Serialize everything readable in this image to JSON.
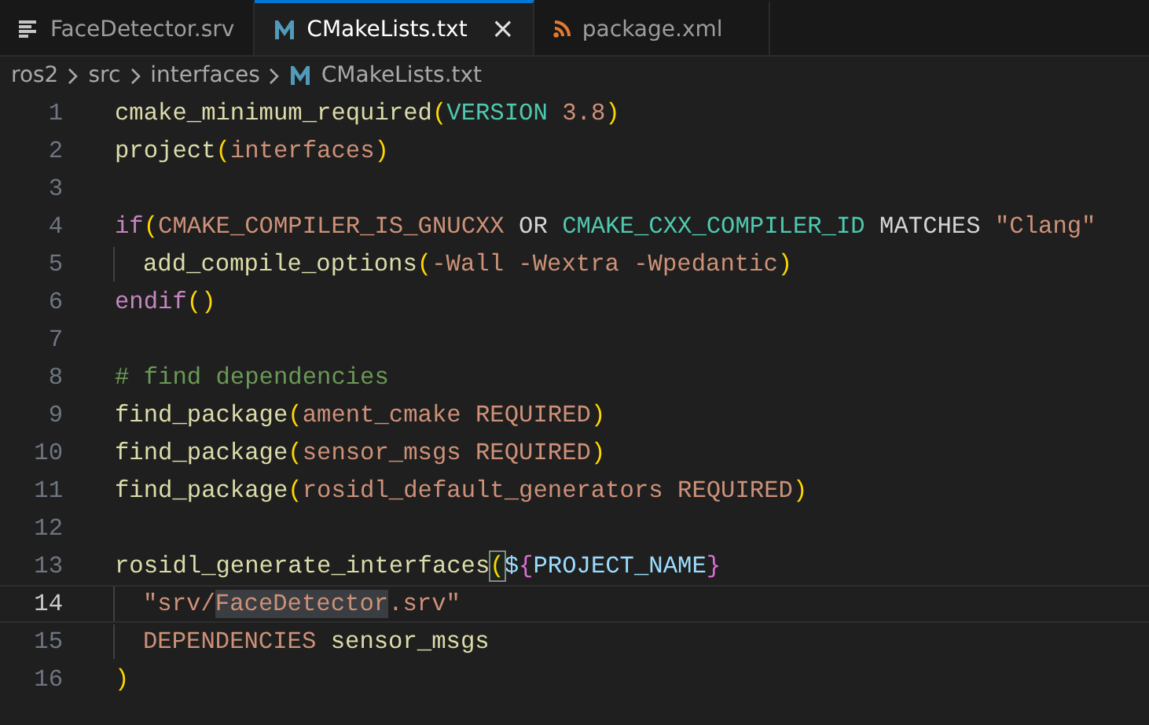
{
  "tabs": [
    {
      "label": "FaceDetector.srv",
      "kind": "text",
      "selected": false
    },
    {
      "label": "CMakeLists.txt",
      "kind": "cmake",
      "selected": true,
      "close": "×"
    },
    {
      "label": "package.xml",
      "kind": "xml",
      "selected": false
    }
  ],
  "breadcrumbs": [
    {
      "label": "ros2",
      "kind": "folder"
    },
    {
      "label": "src",
      "kind": "folder"
    },
    {
      "label": "interfaces",
      "kind": "folder"
    },
    {
      "label": "CMakeLists.txt",
      "kind": "cmake"
    }
  ],
  "lines": [
    {
      "number": "1",
      "current": false,
      "indent": false,
      "tokens": [
        {
          "text": "cmake_minimum_required",
          "kind": "fn"
        },
        {
          "text": "(",
          "kind": "paren"
        },
        {
          "text": "VERSION",
          "kind": "const"
        },
        {
          "text": " 3.8",
          "kind": "arg"
        },
        {
          "text": ")",
          "kind": "paren"
        }
      ]
    },
    {
      "number": "2",
      "current": false,
      "indent": false,
      "tokens": [
        {
          "text": "project",
          "kind": "fn"
        },
        {
          "text": "(",
          "kind": "paren"
        },
        {
          "text": "interfaces",
          "kind": "arg"
        },
        {
          "text": ")",
          "kind": "paren"
        }
      ]
    },
    {
      "number": "3",
      "current": false,
      "indent": false
    },
    {
      "number": "4",
      "current": false,
      "indent": false,
      "tokens": [
        {
          "text": "if",
          "kind": "keyword"
        },
        {
          "text": "(",
          "kind": "paren"
        },
        {
          "text": "CMAKE_COMPILER_IS_GNUCXX",
          "kind": "arg"
        },
        {
          "text": " OR ",
          "kind": "plain"
        },
        {
          "text": "CMAKE_CXX_COMPILER_ID",
          "kind": "const"
        },
        {
          "text": " MATCHES ",
          "kind": "plain"
        },
        {
          "text": "\"Clang\"",
          "kind": "arg"
        }
      ]
    },
    {
      "number": "5",
      "current": false,
      "indent": true,
      "tokens": [
        {
          "text": "add_compile_options",
          "kind": "fn"
        },
        {
          "text": "(",
          "kind": "paren"
        },
        {
          "text": "-Wall -Wextra -Wpedantic",
          "kind": "arg"
        },
        {
          "text": ")",
          "kind": "paren"
        }
      ]
    },
    {
      "number": "6",
      "current": false,
      "indent": false,
      "tokens": [
        {
          "text": "endif",
          "kind": "keyword"
        },
        {
          "text": "()",
          "kind": "paren"
        }
      ]
    },
    {
      "number": "7",
      "current": false,
      "indent": false
    },
    {
      "number": "8",
      "current": false,
      "indent": false,
      "tokens": [
        {
          "text": "# find dependencies",
          "kind": "comment"
        }
      ]
    },
    {
      "number": "9",
      "current": false,
      "indent": false,
      "tokens": [
        {
          "text": "find_package",
          "kind": "fn"
        },
        {
          "text": "(",
          "kind": "paren"
        },
        {
          "text": "ament_cmake REQUIRED",
          "kind": "arg"
        },
        {
          "text": ")",
          "kind": "paren"
        }
      ]
    },
    {
      "number": "10",
      "current": false,
      "indent": false,
      "tokens": [
        {
          "text": "find_package",
          "kind": "fn"
        },
        {
          "text": "(",
          "kind": "paren"
        },
        {
          "text": "sensor_msgs REQUIRED",
          "kind": "arg"
        },
        {
          "text": ")",
          "kind": "paren"
        }
      ]
    },
    {
      "number": "11",
      "current": false,
      "indent": false,
      "tokens": [
        {
          "text": "find_package",
          "kind": "fn"
        },
        {
          "text": "(",
          "kind": "paren"
        },
        {
          "text": "rosidl_default_generators REQUIRED",
          "kind": "arg"
        },
        {
          "text": ")",
          "kind": "paren"
        }
      ]
    },
    {
      "number": "12",
      "current": false,
      "indent": false
    },
    {
      "number": "13",
      "current": false,
      "indent": false,
      "tokens": [
        {
          "text": "rosidl_generate_interfaces",
          "kind": "fn"
        },
        {
          "text": "(",
          "kind": "match"
        },
        {
          "text": "$",
          "kind": "var"
        },
        {
          "text": "{",
          "kind": "brace"
        },
        {
          "text": "PROJECT_NAME",
          "kind": "var"
        },
        {
          "text": "}",
          "kind": "brace"
        }
      ]
    },
    {
      "number": "14",
      "current": true,
      "indent": true,
      "tokens": [
        {
          "text": "\"srv/",
          "kind": "arg"
        },
        {
          "text": "FaceDetector",
          "kind": "highlight"
        },
        {
          "text": ".srv\"",
          "kind": "arg"
        }
      ]
    },
    {
      "number": "15",
      "current": false,
      "indent": true,
      "tokens": [
        {
          "text": "DEPENDENCIES",
          "kind": "arg"
        },
        {
          "text": " sensor_msgs",
          "kind": "fn"
        }
      ]
    },
    {
      "number": "16",
      "current": false,
      "indent": false,
      "tokens": [
        {
          "text": ")",
          "kind": "paren"
        }
      ]
    }
  ]
}
